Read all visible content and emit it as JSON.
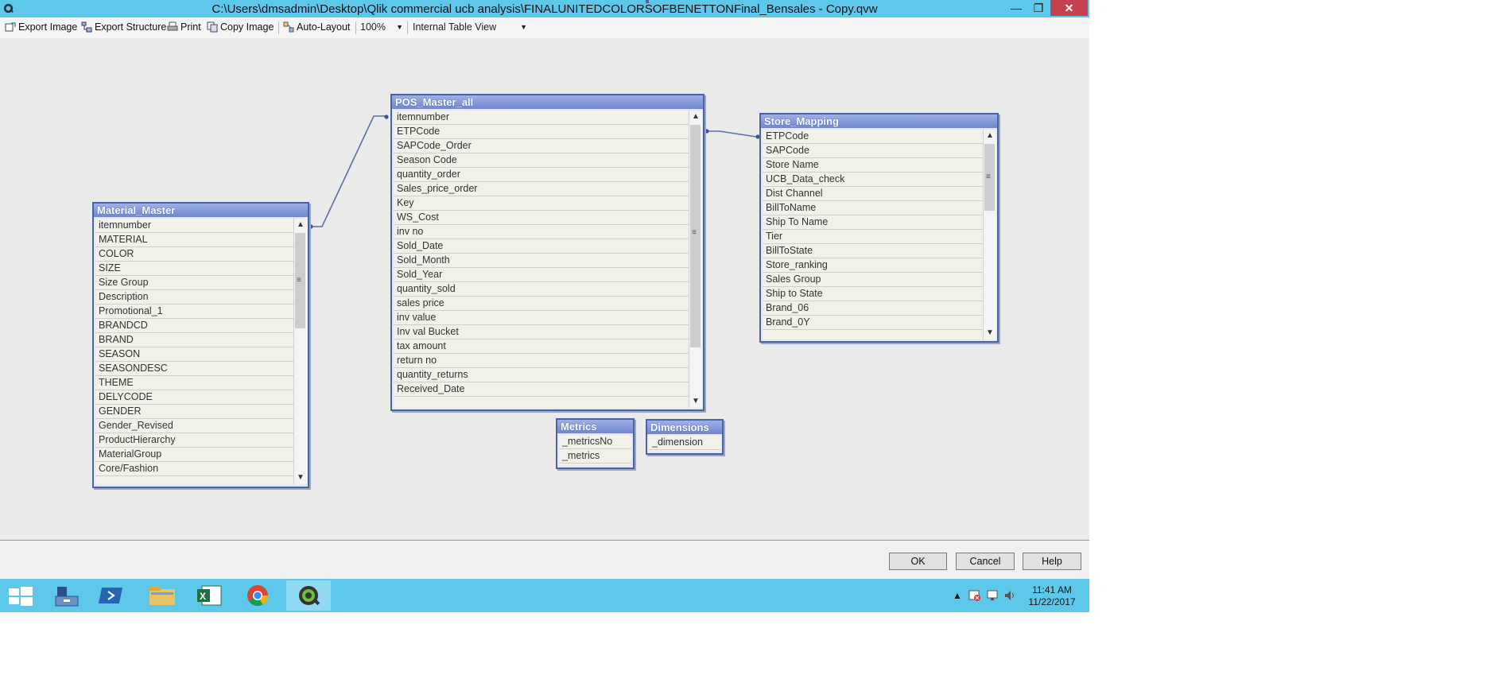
{
  "window": {
    "title": "C:\\Users\\dmsadmin\\Desktop\\Qlik commercial ucb analysis\\FINALUNITEDCOLORSOFBENETTONFinal_Bensales - Copy.qvw",
    "minimize_symbol": "—",
    "maximize_symbol": "❐",
    "close_symbol": "✕"
  },
  "toolbar": {
    "export_image": "Export Image",
    "export_structure": "Export Structure",
    "print": "Print",
    "copy_image": "Copy Image",
    "auto_layout": "Auto-Layout",
    "zoom": "100%",
    "view": "Internal Table View"
  },
  "tables": {
    "pos_master": {
      "name": "POS_Master_all",
      "fields": [
        "itemnumber",
        "ETPCode",
        "SAPCode_Order",
        "Season Code",
        "quantity_order",
        "Sales_price_order",
        "Key",
        "WS_Cost",
        "inv no",
        "Sold_Date",
        "Sold_Month",
        "Sold_Year",
        "quantity_sold",
        "sales price",
        "inv value",
        "Inv val Bucket",
        "tax amount",
        "return no",
        "quantity_returns",
        "Received_Date"
      ]
    },
    "material_master": {
      "name": "Material_Master",
      "fields": [
        "itemnumber",
        "MATERIAL",
        "COLOR",
        "SIZE",
        "Size Group",
        "Description",
        "Promotional_1",
        "BRANDCD",
        "BRAND",
        "SEASON",
        "SEASONDESC",
        "THEME",
        "DELYCODE",
        "GENDER",
        "Gender_Revised",
        "ProductHierarchy",
        "MaterialGroup",
        "Core/Fashion"
      ]
    },
    "store_mapping": {
      "name": "Store_Mapping",
      "fields": [
        "ETPCode",
        "SAPCode",
        "Store Name",
        "UCB_Data_check",
        "Dist Channel",
        "BillToName",
        "Ship To Name",
        "Tier",
        "BillToState",
        "Store_ranking",
        "Sales Group",
        "Ship to State",
        "Brand_06",
        "Brand_0Y"
      ]
    },
    "metrics": {
      "name": "Metrics",
      "fields": [
        "_metricsNo",
        "_metrics"
      ]
    },
    "dimensions": {
      "name": "Dimensions",
      "fields": [
        "_dimension"
      ]
    }
  },
  "dialog_buttons": {
    "ok": "OK",
    "cancel": "Cancel",
    "help": "Help"
  },
  "taskbar": {
    "apps": [
      "windows-start",
      "server-manager",
      "powershell",
      "file-explorer",
      "excel",
      "chrome",
      "qlikview"
    ],
    "clock_time": "11:41 AM",
    "clock_date": "11/22/2017"
  }
}
